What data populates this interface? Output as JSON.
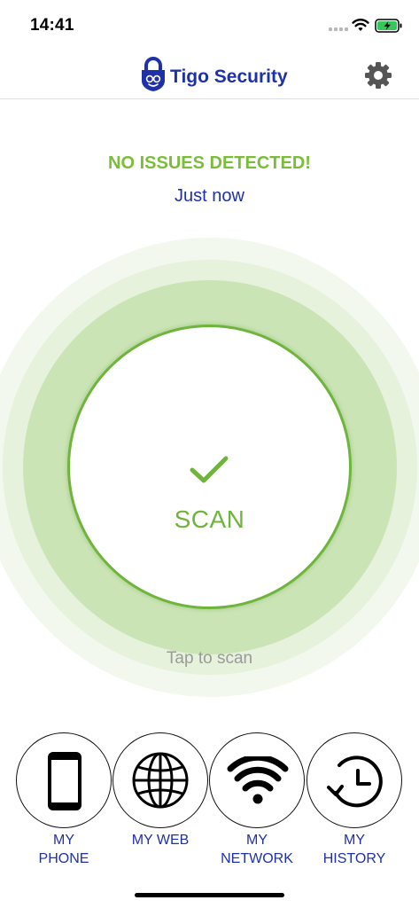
{
  "status_bar": {
    "time": "14:41"
  },
  "header": {
    "title": "Tigo Security",
    "settings_icon": "gear-icon",
    "logo_icon": "padlock-logo-icon"
  },
  "scan_status": {
    "title": "NO ISSUES DETECTED!",
    "last_scan": "Just now",
    "button_label": "SCAN",
    "hint": "Tap to scan"
  },
  "colors": {
    "brand": "#1f31a8",
    "success": "#7bbd3a",
    "ring": "#cbe4b6",
    "hint": "#9a9a9a"
  },
  "bottom_nav": [
    {
      "line1": "MY",
      "line2": "PHONE",
      "icon": "phone-icon"
    },
    {
      "line1": "MY WEB",
      "line2": "",
      "icon": "globe-icon"
    },
    {
      "line1": "MY",
      "line2": "NETWORK",
      "icon": "wifi-icon"
    },
    {
      "line1": "MY",
      "line2": "HISTORY",
      "icon": "history-icon"
    }
  ]
}
